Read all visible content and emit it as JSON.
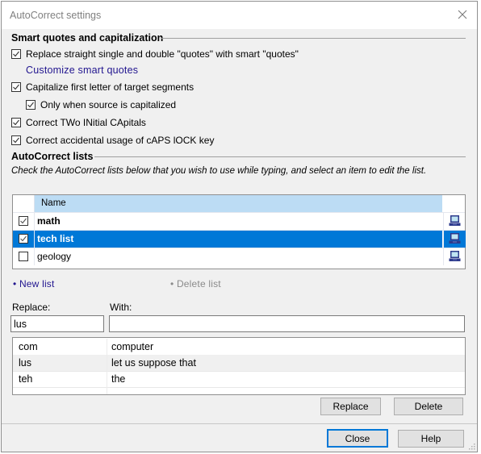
{
  "window": {
    "title": "AutoCorrect settings"
  },
  "smart_quotes": {
    "heading": "Smart quotes and capitalization",
    "options": [
      {
        "label": "Replace straight single and double \"quotes\" with smart \"quotes\"",
        "checked": true
      },
      {
        "label": "Capitalize first letter of target segments",
        "checked": true
      },
      {
        "label": "Only when source is capitalized",
        "checked": true
      },
      {
        "label": "Correct TWo INitial CApitals",
        "checked": true
      },
      {
        "label": "Correct accidental usage of cAPS lOCK key",
        "checked": true
      }
    ],
    "customize_link": "Customize smart quotes"
  },
  "autocorrect_lists": {
    "heading": "AutoCorrect lists",
    "description": "Check the AutoCorrect lists below that you wish to use while typing, and select an item to edit the list.",
    "column_name": "Name",
    "items": [
      {
        "name": "math",
        "checked": true,
        "selected": false,
        "icon": "computer-icon"
      },
      {
        "name": "tech list",
        "checked": true,
        "selected": true,
        "icon": "computer-icon"
      },
      {
        "name": "geology",
        "checked": false,
        "selected": false,
        "icon": "computer-icon"
      }
    ],
    "new_list": "New list",
    "delete_list": "Delete list"
  },
  "editor": {
    "replace_label": "Replace:",
    "with_label": "With:",
    "replace_value": "lus",
    "with_value": "",
    "entries": [
      {
        "replace": "com",
        "with": "computer"
      },
      {
        "replace": "lus",
        "with": "let us suppose that"
      },
      {
        "replace": "teh",
        "with": "the"
      }
    ],
    "replace_button": "Replace",
    "delete_button": "Delete"
  },
  "footer": {
    "close_button": "Close",
    "help_button": "Help"
  },
  "colors": {
    "selection": "#0078d7",
    "header": "#bcdcf4",
    "link": "#21158f"
  }
}
